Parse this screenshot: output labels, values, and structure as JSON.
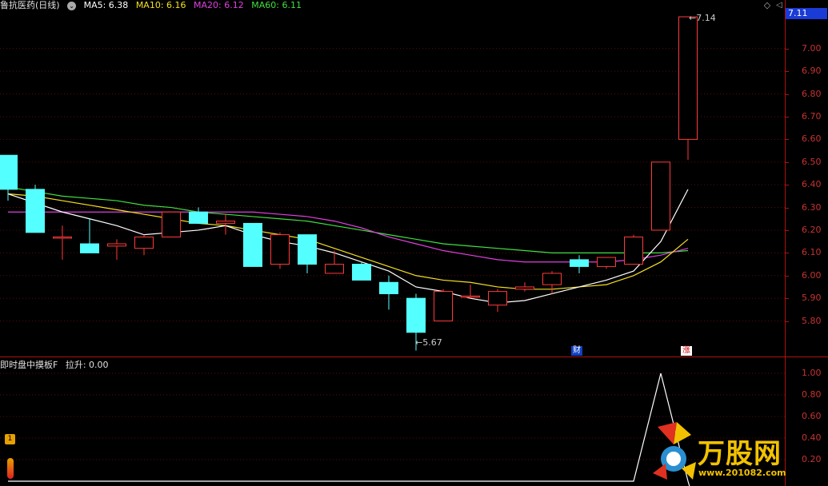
{
  "header": {
    "stock_title": "鲁抗医药(日线)",
    "ma5": "MA5: 6.38",
    "ma10": "MA10: 6.16",
    "ma20": "MA20: 6.12",
    "ma60": "MA60: 6.11",
    "colors": {
      "ma5": "#ffffff",
      "ma10": "#f5e020",
      "ma20": "#e040e0",
      "ma60": "#40e040",
      "title": "#e0e0e0"
    }
  },
  "current_price": "7.11",
  "price_axis": [
    "7.00",
    "6.90",
    "6.80",
    "6.70",
    "6.60",
    "6.50",
    "6.40",
    "6.30",
    "6.20",
    "6.10",
    "6.00",
    "5.90",
    "5.80"
  ],
  "annotations": {
    "high": "7.14",
    "low": "5.67"
  },
  "event_markers": {
    "finance": "财",
    "limit_up": "涨"
  },
  "indicator": {
    "title": "即时盘中摸板F",
    "value_label": "拉升: 0.00",
    "axis": [
      "1.00",
      "0.80",
      "0.60",
      "0.40",
      "0.20"
    ]
  },
  "side_badges": {
    "badge1": "1"
  },
  "logo": {
    "text": "万股网",
    "url": "www.201082.com"
  },
  "chart_data": {
    "type": "candlestick",
    "ylim": [
      5.62,
      7.16
    ],
    "candles": [
      {
        "o": 6.53,
        "h": 6.53,
        "l": 6.33,
        "c": 6.38
      },
      {
        "o": 6.38,
        "h": 6.4,
        "l": 6.19,
        "c": 6.19
      },
      {
        "o": 6.17,
        "h": 6.22,
        "l": 6.07,
        "c": 6.17
      },
      {
        "o": 6.14,
        "h": 6.25,
        "l": 6.1,
        "c": 6.1
      },
      {
        "o": 6.13,
        "h": 6.16,
        "l": 6.07,
        "c": 6.14
      },
      {
        "o": 6.12,
        "h": 6.18,
        "l": 6.09,
        "c": 6.17
      },
      {
        "o": 6.17,
        "h": 6.28,
        "l": 6.17,
        "c": 6.28
      },
      {
        "o": 6.28,
        "h": 6.3,
        "l": 6.23,
        "c": 6.23
      },
      {
        "o": 6.23,
        "h": 6.27,
        "l": 6.18,
        "c": 6.24
      },
      {
        "o": 6.23,
        "h": 6.23,
        "l": 6.04,
        "c": 6.04
      },
      {
        "o": 6.05,
        "h": 6.19,
        "l": 6.03,
        "c": 6.18
      },
      {
        "o": 6.18,
        "h": 6.18,
        "l": 6.01,
        "c": 6.05
      },
      {
        "o": 6.01,
        "h": 6.11,
        "l": 6.01,
        "c": 6.05
      },
      {
        "o": 6.05,
        "h": 6.06,
        "l": 5.98,
        "c": 5.98
      },
      {
        "o": 5.97,
        "h": 6.0,
        "l": 5.85,
        "c": 5.92
      },
      {
        "o": 5.9,
        "h": 5.92,
        "l": 5.67,
        "c": 5.75
      },
      {
        "o": 5.8,
        "h": 5.94,
        "l": 5.8,
        "c": 5.93
      },
      {
        "o": 5.91,
        "h": 5.96,
        "l": 5.9,
        "c": 5.91
      },
      {
        "o": 5.87,
        "h": 5.94,
        "l": 5.84,
        "c": 5.93
      },
      {
        "o": 5.94,
        "h": 5.97,
        "l": 5.93,
        "c": 5.95
      },
      {
        "o": 5.96,
        "h": 6.02,
        "l": 5.92,
        "c": 6.01
      },
      {
        "o": 6.07,
        "h": 6.09,
        "l": 6.01,
        "c": 6.04
      },
      {
        "o": 6.04,
        "h": 6.08,
        "l": 6.03,
        "c": 6.08
      },
      {
        "o": 6.05,
        "h": 6.18,
        "l": 6.05,
        "c": 6.17
      },
      {
        "o": 6.2,
        "h": 6.5,
        "l": 6.2,
        "c": 6.5
      },
      {
        "o": 6.6,
        "h": 7.14,
        "l": 6.51,
        "c": 7.14
      }
    ],
    "ma5": [
      6.36,
      6.32,
      6.28,
      6.25,
      6.22,
      6.18,
      6.19,
      6.2,
      6.22,
      6.18,
      6.15,
      6.13,
      6.1,
      6.06,
      6.02,
      5.95,
      5.93,
      5.9,
      5.88,
      5.89,
      5.92,
      5.95,
      5.98,
      6.02,
      6.15,
      6.38
    ],
    "ma10": [
      6.36,
      6.35,
      6.33,
      6.31,
      6.29,
      6.27,
      6.25,
      6.23,
      6.22,
      6.2,
      6.18,
      6.16,
      6.12,
      6.08,
      6.04,
      6.0,
      5.98,
      5.97,
      5.95,
      5.94,
      5.94,
      5.95,
      5.96,
      6.0,
      6.06,
      6.16
    ],
    "ma20": [
      6.28,
      6.28,
      6.28,
      6.28,
      6.28,
      6.28,
      6.28,
      6.28,
      6.28,
      6.28,
      6.27,
      6.26,
      6.24,
      6.21,
      6.17,
      6.14,
      6.11,
      6.09,
      6.07,
      6.06,
      6.06,
      6.06,
      6.06,
      6.07,
      6.09,
      6.12
    ],
    "ma60": [
      6.39,
      6.37,
      6.35,
      6.34,
      6.33,
      6.31,
      6.3,
      6.28,
      6.27,
      6.26,
      6.25,
      6.24,
      6.22,
      6.2,
      6.18,
      6.16,
      6.14,
      6.13,
      6.12,
      6.11,
      6.1,
      6.1,
      6.1,
      6.1,
      6.1,
      6.11
    ],
    "indicator_values": [
      0,
      0,
      0,
      0,
      0,
      0,
      0,
      0,
      0,
      0,
      0,
      0,
      0,
      0,
      0,
      0,
      0,
      0,
      0,
      0,
      0,
      0,
      0,
      0,
      1,
      0
    ]
  }
}
